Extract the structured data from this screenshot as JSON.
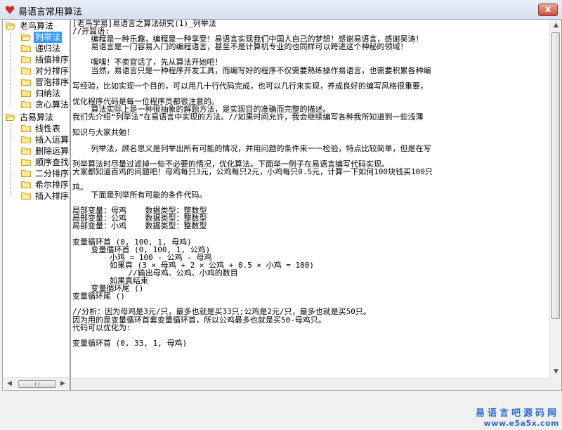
{
  "window": {
    "title": "易语言常用算法",
    "close_label": "x"
  },
  "tree": {
    "groups": [
      {
        "label": "老鸟算法",
        "children": [
          "列举法",
          "递归法",
          "插值排序",
          "对分排序",
          "冒泡排序",
          "归纳法",
          "贪心算法"
        ]
      },
      {
        "label": "古易算法",
        "children": [
          "线性表",
          "插入运算",
          "删除运算",
          "顺序查找",
          "二分排序",
          "希尔排序",
          "插入排序"
        ]
      }
    ],
    "selected": "列举法"
  },
  "content": {
    "lines": [
      "[老鸟学易]易语言之算法研究(1)_列举法",
      "//开篇语:",
      "    编程是一种乐趣，编程是一种享受！易语言实现我们中国人自己的梦想！感谢易语言，感谢吴涛！",
      "    易语言是一门容易入门的编程语言，甚至不是计算机专业的也同样可以跨进这个神秘的领域！",
      "",
      "    嘿嘿！不卖官话了，先从算法开始吧！",
      "    当然，易语言只是一种程序开发工具，而编写好的程序不仅需要熟练操作易语言，也需要积累各种编",
      "",
      "写经验，比如实现一个目的，可以用几十行代码完成，也可以几行来实现，养成良好的编写风格很重要，",
      "",
      "优化程序代码是每一位程序员都很注意的。",
      "    算法实际上是一种很抽象的解题方法，是实现目的准确而完整的描述。",
      "我们先介绍“列举法”在易语言中实现的方法。//如果时间允许，我会继续编写各种我所知道到一些浅薄",
      "",
      "知识与大家共勉！",
      "",
      "    列举法，顾名思义是列举出所有可能的情况，并用问题的条件来一一检验，特点比较简单，但是在写",
      "",
      "列举算法时尽量过滤掉一些不必要的情况，优化算法。下面举一例子在易语言编写代码实现。",
      "大家都知道百鸡的问题吧！母鸡每只3元，公鸡每只2元，小鸡每只0.5元，计算一下如何100块钱买100只",
      "",
      "鸡。",
      "    下面是列举所有可能的条件代码。",
      "",
      "局部变量：母鸡    数据类型：整数型",
      "局部变量：公鸡    数据类型：整数型",
      "局部变量：小鸡    数据类型：整数型",
      "",
      "变量循环首 (0, 100, 1, 母鸡)",
      "    变量循环首 (0, 100, 1, 公鸡)",
      "        小鸡 = 100 - 公鸡 - 母鸡",
      "        如果真 (3 × 母鸡 + 2 × 公鸡 + 0.5 × 小鸡 = 100)",
      "            //输出母鸡、公鸡、小鸡的数目",
      "        如果真结束",
      "    变量循环尾 ()",
      "变量循环尾 ()",
      "",
      "//分析：因为母鸡是3元/只，最多也就是买33只;公鸡是2元/只，最多也就是买50只。",
      "因为用的是变量循环首套变量循环首，所以公鸡最多也就是买50-母鸡只。",
      "代码可以优化为:",
      "",
      "变量循环首 (0, 33, 1, 母鸡)"
    ]
  },
  "watermark": {
    "site_name": "易语言吧源码网",
    "url": "www.e5a5x.com"
  },
  "colors": {
    "selection": "#3399ff",
    "watermark": "#2e6bd1",
    "close_button": "#c8503a"
  }
}
